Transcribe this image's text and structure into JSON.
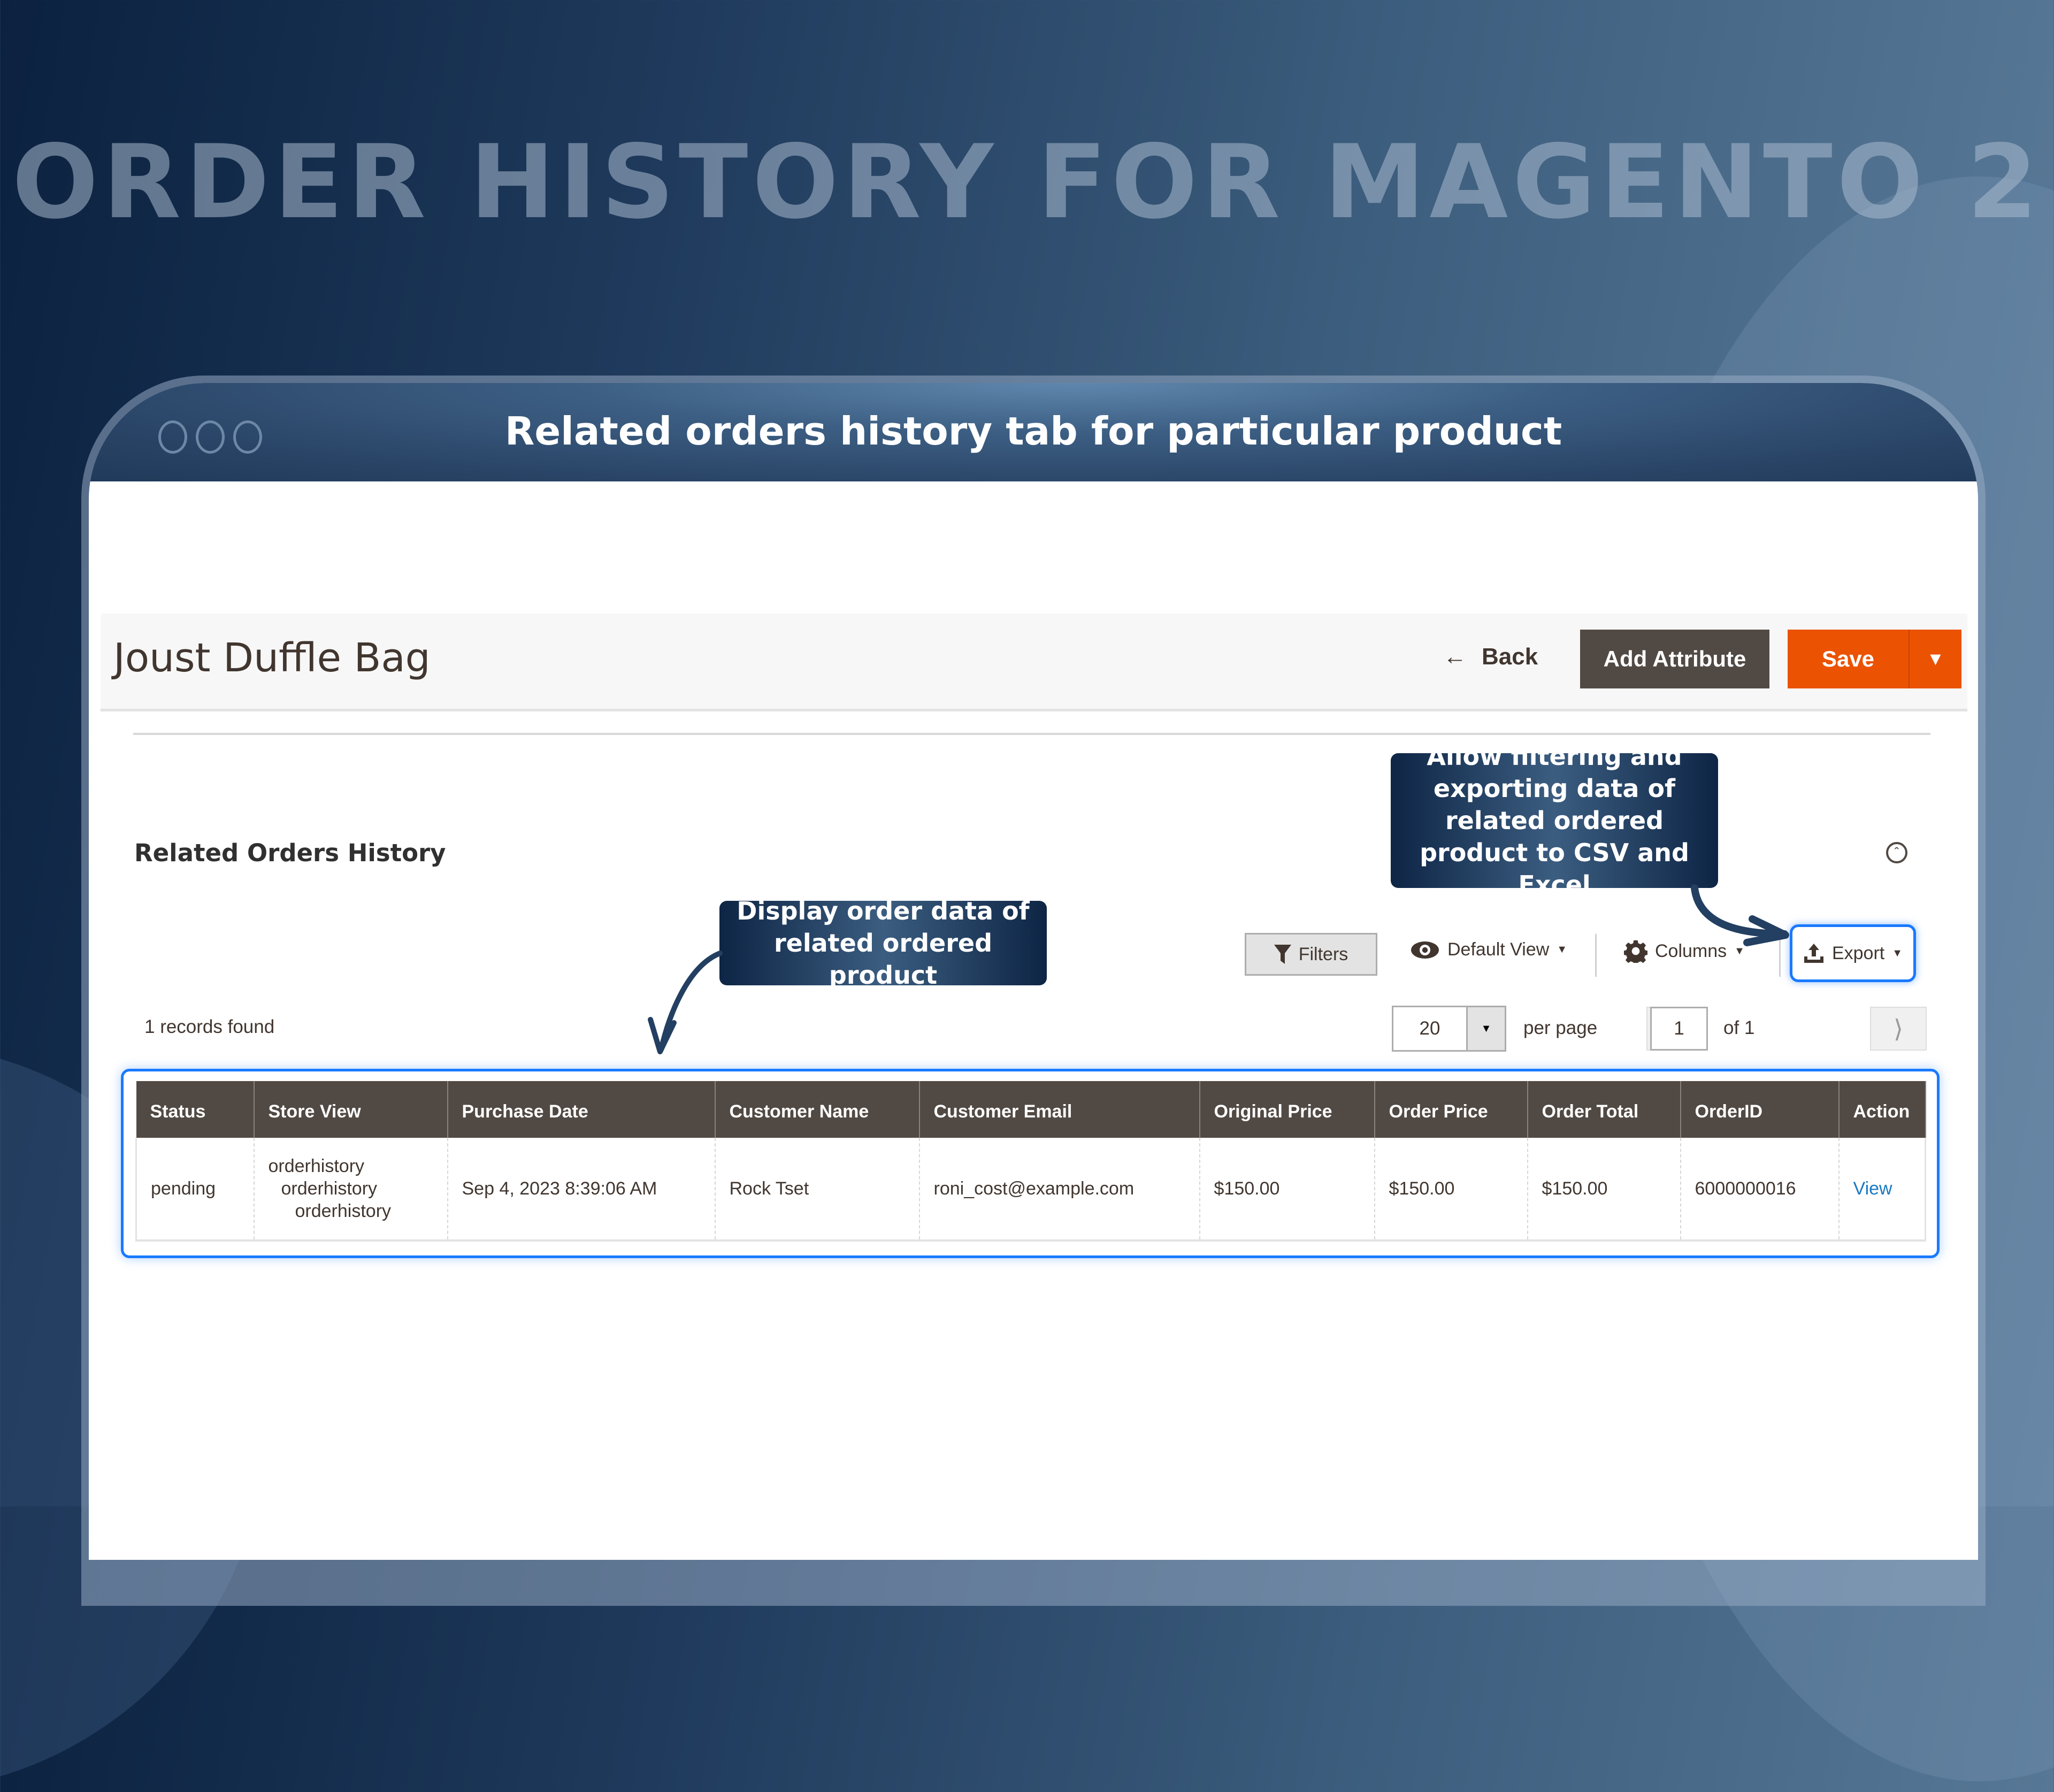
{
  "hero": {
    "title": "ORDER HISTORY FOR MAGENTO 2"
  },
  "window": {
    "title": "Related orders history tab for particular product"
  },
  "header": {
    "product_title": "Joust Duffle Bag",
    "back_label": "Back",
    "add_attribute_label": "Add Attribute",
    "save_label": "Save"
  },
  "section": {
    "title": "Related Orders History"
  },
  "callouts": {
    "export": "Allow filtering and exporting data of related ordered product to CSV and Excel",
    "display": "Display order data of related ordered product"
  },
  "toolbar": {
    "filters_label": "Filters",
    "view_label": "Default View",
    "columns_label": "Columns",
    "export_label": "Export"
  },
  "grid": {
    "records_found": "1 records found",
    "per_page_value": "20",
    "per_page_label": "per page",
    "current_page": "1",
    "page_total": "of 1",
    "columns": [
      "Status",
      "Store View",
      "Purchase Date",
      "Customer Name",
      "Customer Email",
      "Original Price",
      "Order Price",
      "Order Total",
      "OrderID",
      "Action"
    ],
    "rows": [
      {
        "status": "pending",
        "store_view": [
          "orderhistory",
          "orderhistory",
          "orderhistory"
        ],
        "purchase_date": "Sep 4, 2023 8:39:06 AM",
        "customer_name": "Rock Tset",
        "customer_email": "roni_cost@example.com",
        "original_price": "$150.00",
        "order_price": "$150.00",
        "order_total": "$150.00",
        "order_id": "6000000016",
        "action": "View"
      }
    ]
  },
  "colors": {
    "accent_orange": "#eb5202",
    "header_dark": "#514943",
    "highlight_blue": "#1979ff",
    "link_blue": "#1979c3"
  }
}
